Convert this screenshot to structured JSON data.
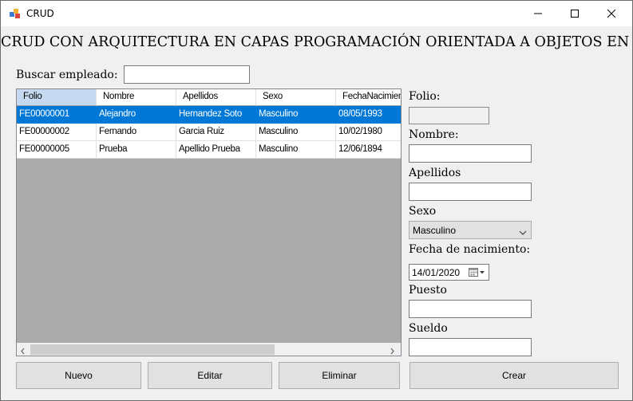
{
  "window": {
    "title": "CRUD"
  },
  "heading": "CRUD CON ARQUITECTURA EN CAPAS PROGRAMACIÓN ORIENTADA A OBJETOS EN C#",
  "search": {
    "label": "Buscar empleado:",
    "value": ""
  },
  "grid": {
    "columns": [
      "Folio",
      "Nombre",
      "Apellidos",
      "Sexo",
      "FechaNacimiento"
    ],
    "rows": [
      {
        "folio": "FE00000001",
        "nombre": "Alejandro",
        "apellidos": "Hernandez Soto",
        "sexo": "Masculino",
        "fecha": "08/05/1993",
        "selected": true
      },
      {
        "folio": "FE00000002",
        "nombre": "Fernando",
        "apellidos": "Garcia Ruiz",
        "sexo": "Masculino",
        "fecha": "10/02/1980",
        "selected": false
      },
      {
        "folio": "FE00000005",
        "nombre": "Prueba",
        "apellidos": "Apellido Prueba",
        "sexo": "Masculino",
        "fecha": "12/06/1894",
        "selected": false
      }
    ]
  },
  "form": {
    "folio_label": "Folio:",
    "folio_value": "",
    "nombre_label": "Nombre:",
    "nombre_value": "",
    "apellidos_label": "Apellidos",
    "apellidos_value": "",
    "sexo_label": "Sexo",
    "sexo_value": "Masculino",
    "fecha_label": "Fecha de nacimiento:",
    "fecha_value": "14/01/2020",
    "puesto_label": "Puesto",
    "puesto_value": "",
    "sueldo_label": "Sueldo",
    "sueldo_value": ""
  },
  "buttons": {
    "nuevo": "Nuevo",
    "editar": "Editar",
    "eliminar": "Eliminar",
    "crear": "Crear"
  },
  "colors": {
    "selection": "#0078d7",
    "header_selected": "#c5daf0",
    "grid_background": "#ababab",
    "window_background": "#f0f0f0"
  }
}
